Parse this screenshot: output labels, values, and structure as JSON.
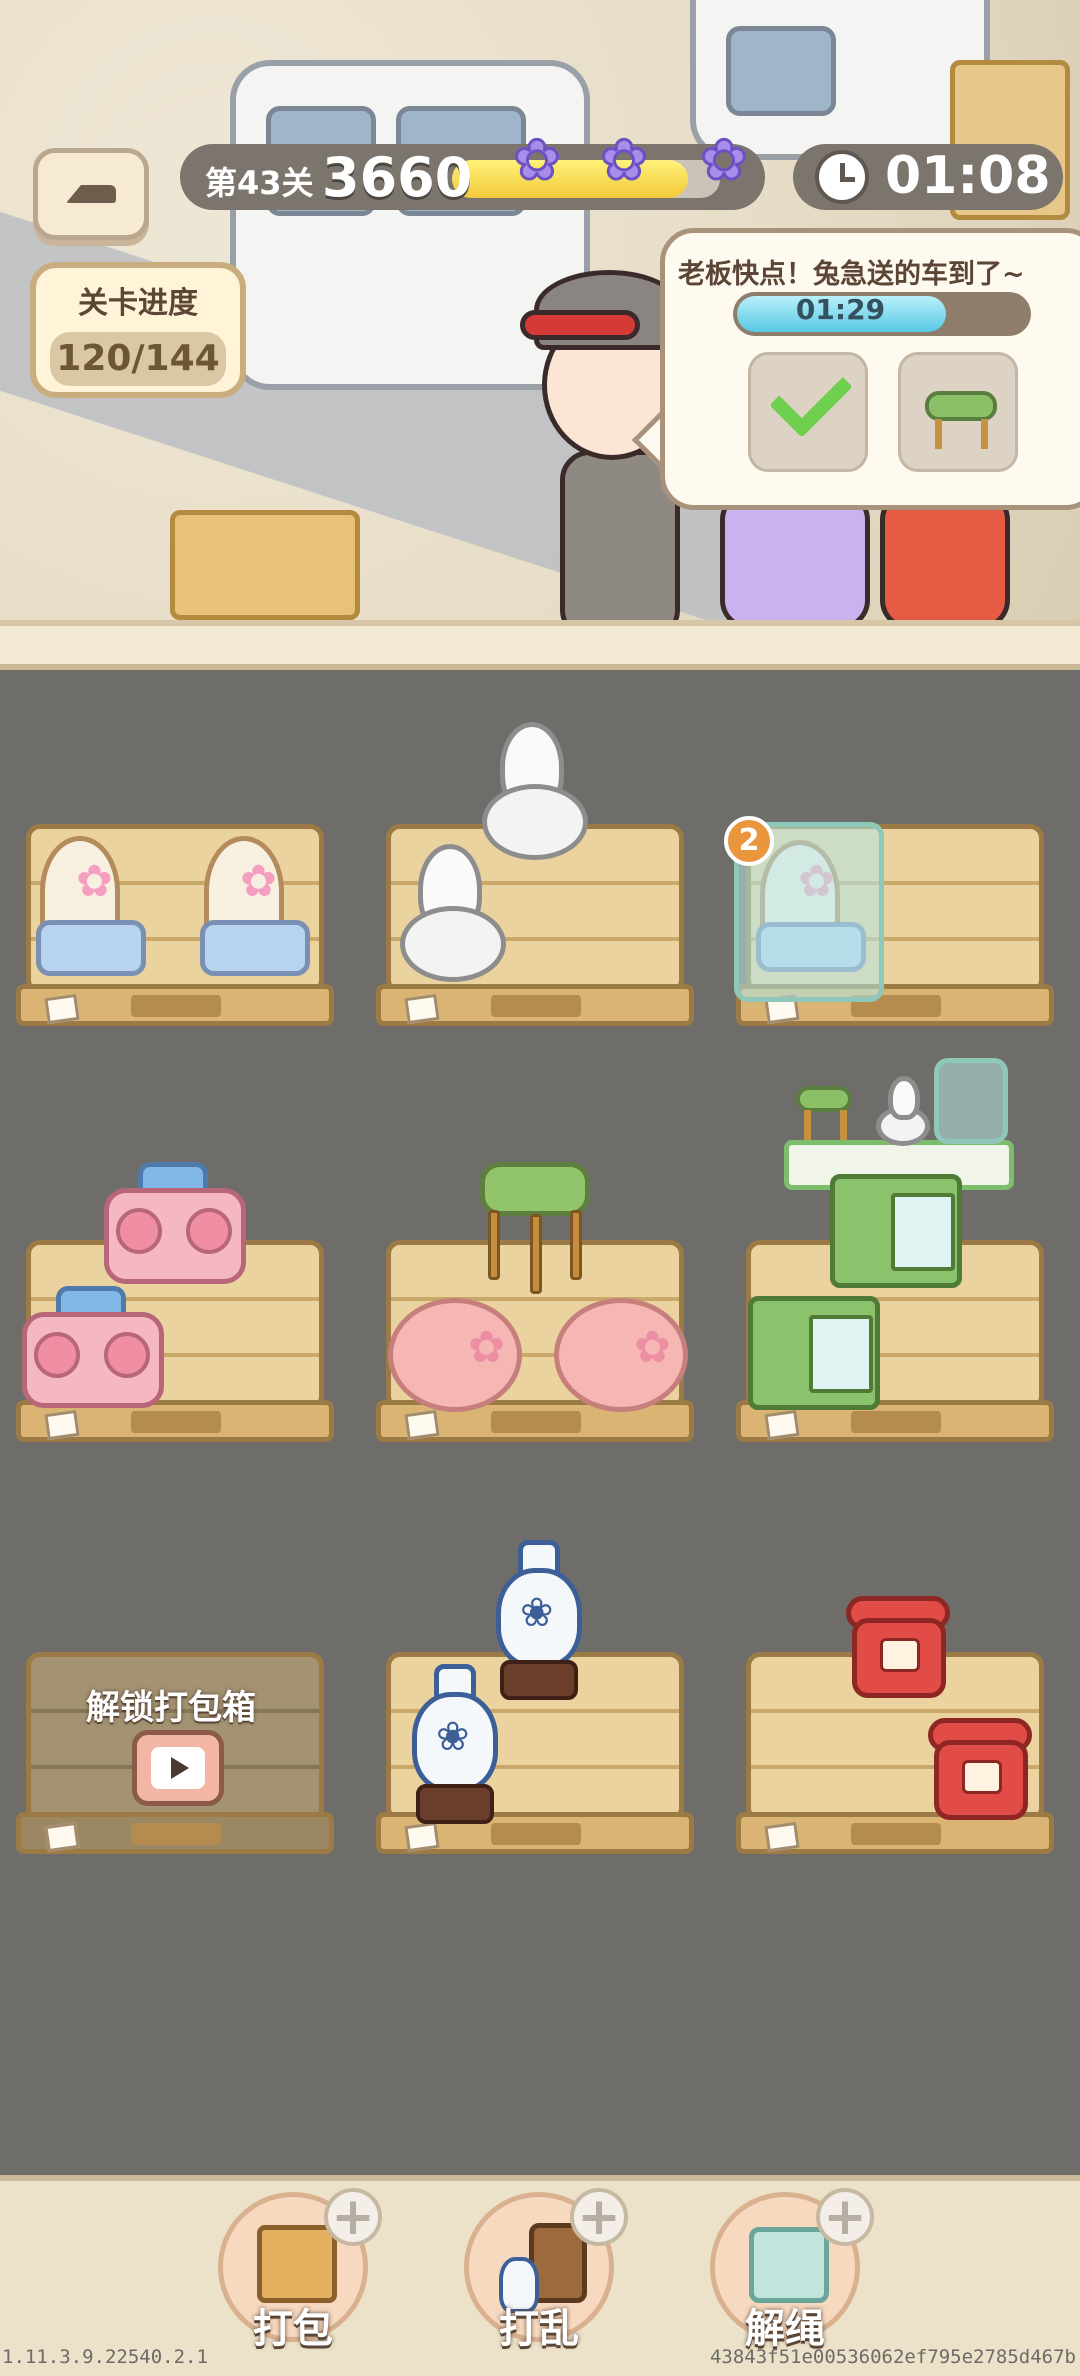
{
  "hud": {
    "level_label": "第43关",
    "score": "3660",
    "star_progress": 0.88,
    "stars_earned": 3,
    "timer": "01:08",
    "level_progress_title": "关卡进度",
    "level_progress_value": "120/144"
  },
  "order": {
    "message": "老板快点！兔急送的车到了~",
    "timer": "01:29",
    "timer_progress": 0.72,
    "slots": [
      {
        "icon": "check-icon",
        "done": true
      },
      {
        "icon": "green-stool-icon",
        "done": false
      }
    ]
  },
  "shelves": [
    {
      "id": 1,
      "items": [
        "rattan-chair",
        "rattan-chair"
      ]
    },
    {
      "id": 2,
      "items": [
        "toilet",
        "toilet"
      ]
    },
    {
      "id": 3,
      "items": [
        "packed-rattan-chair"
      ],
      "count": "2"
    },
    {
      "id": 4,
      "items": [
        "pink-radio",
        "pink-radio"
      ]
    },
    {
      "id": 5,
      "items": [
        "green-stool",
        "pink-ottoman",
        "pink-ottoman"
      ]
    },
    {
      "id": 6,
      "items": [
        "green-cabinet",
        "green-cabinet"
      ],
      "stack": [
        "green-stool",
        "toilet",
        "packed-cabinet"
      ]
    },
    {
      "id": 7,
      "locked": true,
      "label": "解锁打包箱"
    },
    {
      "id": 8,
      "items": [
        "blue-white-vase",
        "blue-white-vase"
      ]
    },
    {
      "id": 9,
      "items": [
        "red-phone",
        "red-phone"
      ]
    }
  ],
  "tools": [
    {
      "label": "打包",
      "icon": "box-icon"
    },
    {
      "label": "打乱",
      "icon": "shuffle-icon"
    },
    {
      "label": "解绳",
      "icon": "untie-icon"
    }
  ],
  "plus_glyph": "+",
  "footer": {
    "version": "1.11.3.9.22540.2.1",
    "build_id": "43843f51e00536062ef795e2785d467b"
  },
  "colors": {
    "hud_pill": "#7c756e",
    "shelf_wood": "#ead39e",
    "floor": "#6f6d69",
    "star_fill": "#f2c93a",
    "order_timer_fill": "#58c7e3"
  }
}
